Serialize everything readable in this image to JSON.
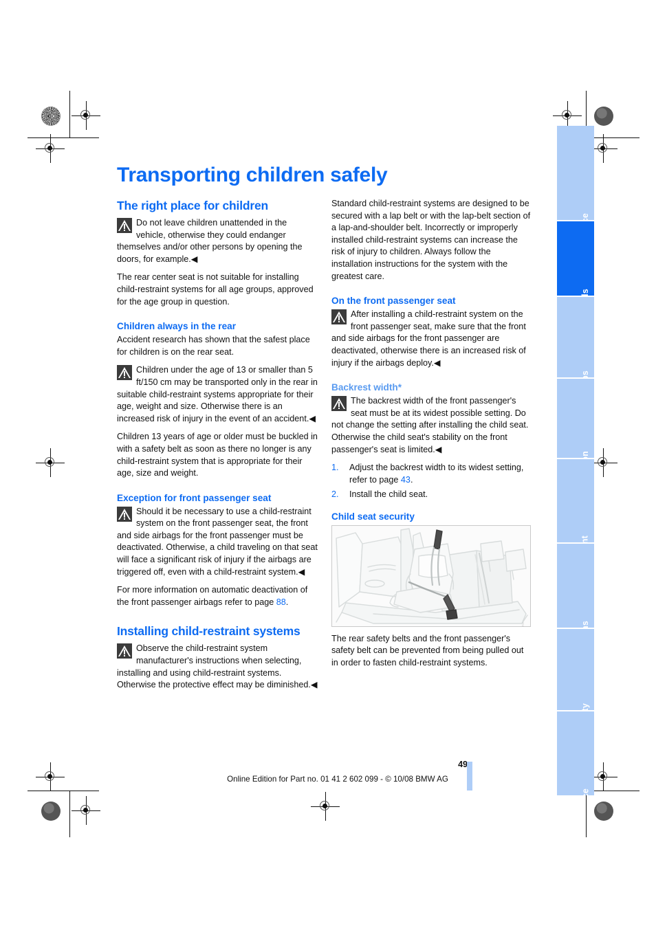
{
  "document": {
    "title": "Transporting children safely",
    "page_number": "49",
    "footer": "Online Edition for Part no. 01 41 2 602 099 - © 10/08 BMW AG",
    "accent_color": "#0d6bf2",
    "tab_color": "#aecdf7"
  },
  "sidebar": {
    "tabs": [
      {
        "label": "At a glance",
        "active": false
      },
      {
        "label": "Controls",
        "active": true
      },
      {
        "label": "Driving tips",
        "active": false
      },
      {
        "label": "Navigation",
        "active": false
      },
      {
        "label": "Entertainment",
        "active": false
      },
      {
        "label": "Communications",
        "active": false
      },
      {
        "label": "Mobility",
        "active": false
      },
      {
        "label": "Reference",
        "active": false
      }
    ]
  },
  "left_column": {
    "section_heading": "The right place for children",
    "warning_1": "Do not leave children unattended in the vehicle, otherwise they could endanger themselves and/or other persons by opening the doors, for example.◀",
    "para_1": "The rear center seat is not suitable for installing child-restraint systems for all age groups, approved for the age group in question.",
    "sub_1": "Children always in the rear",
    "para_2": "Accident research has shown that the safest place for children is on the rear seat.",
    "warning_2": "Children under the age of 13 or smaller than 5 ft/150 cm may be transported only in the rear in suitable child-restraint systems appropriate for their age, weight and size. Otherwise there is an increased risk of injury in the event of an accident.◀",
    "para_3": "Children 13 years of age or older must be buckled in with a safety belt as soon as there no longer is any child-restraint system that is appropriate for their age, size and weight.",
    "sub_2": "Exception for front passenger seat",
    "warning_3": "Should it be necessary to use a child-restraint system on the front passenger seat, the front and side airbags for the front passenger must be deactivated. Otherwise, a child traveling on that seat will face a significant risk of injury if the airbags are triggered off, even with a child-restraint system.◀",
    "para_4_before": "For more information on automatic deactivation of the front passenger airbags refer to page ",
    "para_4_pageref": "88",
    "para_4_after": ".",
    "section_heading_2": "Installing child-restraint systems",
    "warning_4": "Observe the child-restraint system manufacturer's instructions when selecting, installing and using child-restraint systems. Otherwise the protective effect may be diminished.◀"
  },
  "right_column": {
    "para_1": "Standard child-restraint systems are designed to be secured with a lap belt or with the lap-belt section of a lap-and-shoulder belt. Incorrectly or improperly installed child-restraint systems can increase the risk of injury to children. Always follow the installation instructions for the system with the greatest care.",
    "sub_1": "On the front passenger seat",
    "warning_1": "After installing a child-restraint system on the front passenger seat, make sure that the front and side airbags for the front passenger are deactivated, otherwise there is an increased risk of injury if the airbags deploy.◀",
    "sub_2": "Backrest width*",
    "warning_2": "The backrest width of the front passenger's seat must be at its widest possible setting. Do not change the setting after installing the child seat. Otherwise the child seat's stability on the front passenger's seat is limited.◀",
    "steps": [
      {
        "num": "1.",
        "text_before": "Adjust the backrest width to its widest setting, refer to page ",
        "pageref": "43",
        "text_after": "."
      },
      {
        "num": "2.",
        "text_before": "Install the child seat.",
        "pageref": "",
        "text_after": ""
      }
    ],
    "sub_3": "Child seat security",
    "figure_caption": "The rear safety belts and the front passenger's safety belt can be prevented from being pulled out in order to fasten child-restraint systems.",
    "figure_alt": "Line drawing of a vehicle rear seat bench with a child seat installed and the safety belt routed through it"
  }
}
